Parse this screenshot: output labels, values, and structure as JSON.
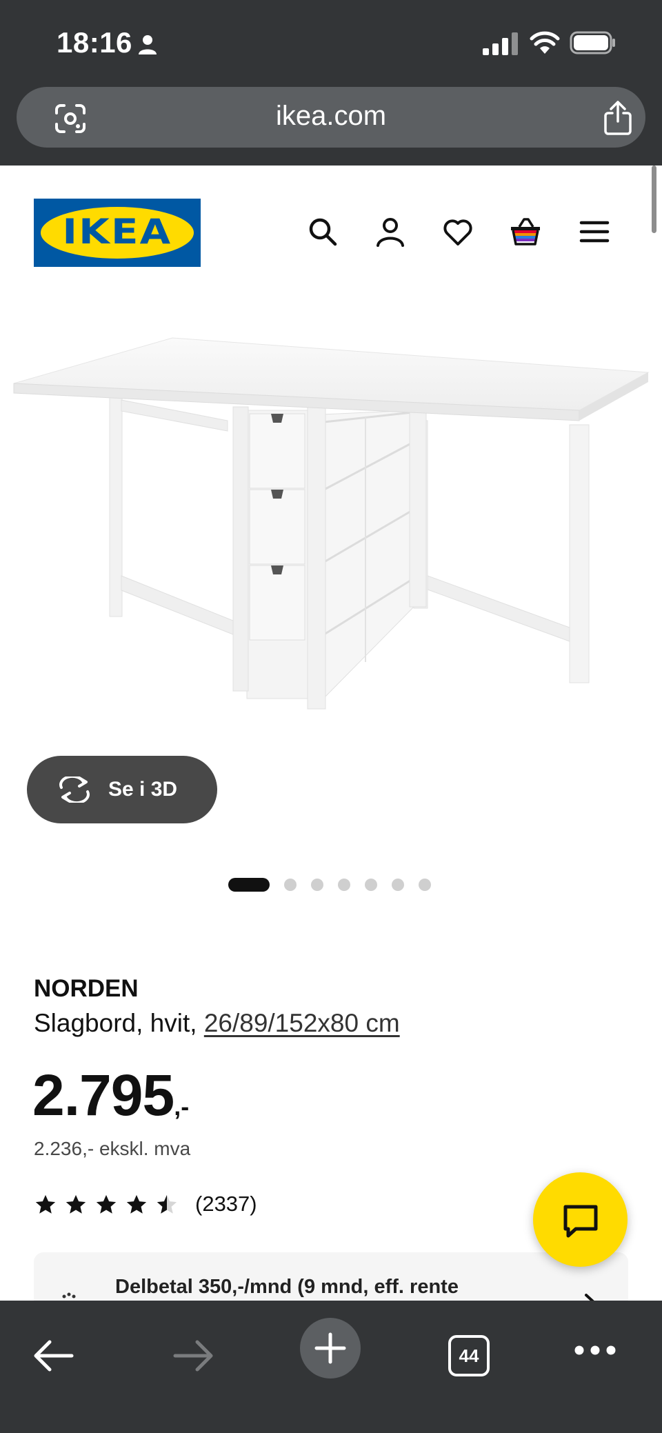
{
  "status_bar": {
    "time": "18:16"
  },
  "browser": {
    "url": "ikea.com",
    "tab_count": "44"
  },
  "header": {
    "logo_text": "IKEA",
    "icons": [
      "search-icon",
      "account-icon",
      "favourites-heart-icon",
      "shopping-basket-icon",
      "menu-hamburger-icon"
    ]
  },
  "gallery": {
    "view_3d_label": "Se i 3D",
    "image_count": 7,
    "active_index": 0
  },
  "product": {
    "name": "NORDEN",
    "description": "Slagbord, hvit,",
    "measurements": "26/89/152x80 cm",
    "price_main": "2.795",
    "price_suffix": ",-",
    "price_ex_vat": "2.236,- ekskl. mva",
    "rating_value": 4.5,
    "rating_max": 5,
    "rating_count": "(2337)"
  },
  "finance": {
    "text": "Delbetal 350,-/mnd (9 mnd, eff. rente"
  },
  "colors": {
    "ikea_blue": "#0058a3",
    "ikea_yellow": "#ffdb00",
    "browser_chrome": "#333537"
  }
}
